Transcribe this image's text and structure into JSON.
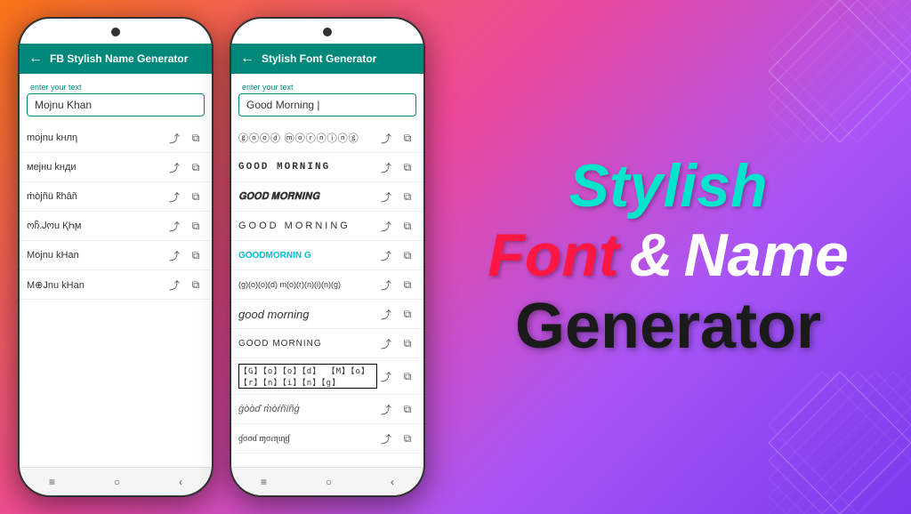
{
  "phone1": {
    "header": {
      "back": "←",
      "title": "FB Stylish Name Generator"
    },
    "input": {
      "label": "enter your text",
      "value": "Mojnu Khan"
    },
    "results": [
      {
        "text": "mojnu kнлη",
        "style": ""
      },
      {
        "text": "мejнu kнди",
        "style": ""
      },
      {
        "text": "ṁòjñü k̃hâñ",
        "style": ""
      },
      {
        "text": "ოჩ.Ꭻოu ҚҺϻ",
        "style": ""
      },
      {
        "text": "Mojnu kHan",
        "style": ""
      },
      {
        "text": "M⊕Jnu kHan",
        "style": ""
      }
    ],
    "nav": [
      "≡",
      "○",
      "‹"
    ]
  },
  "phone2": {
    "header": {
      "back": "←",
      "title": "Stylish Font Generator"
    },
    "input": {
      "label": "enter your text",
      "value": "Good Morning |"
    },
    "results": [
      {
        "text": "ⓖⓞⓞⓓ ⓜⓞⓡⓝⓘⓝⓖ",
        "style": "circled"
      },
      {
        "text": "GOOD MORNING",
        "style": "outlined"
      },
      {
        "text": "𝐆𝐎𝐎𝐃 𝐌𝐎𝐑𝐍𝐈𝐍𝐆",
        "style": "bold-serif"
      },
      {
        "text": "GOOD MORNING",
        "style": "wide"
      },
      {
        "text": "GOODMORNIN G",
        "style": "colored"
      },
      {
        "text": "(g)(o)(o)(d) m(o)(r)(n)(i)(n)(g)",
        "style": "parentheses"
      },
      {
        "text": "good morning",
        "style": "italic-light"
      },
      {
        "text": "GOOD MORNING",
        "style": "caps"
      },
      {
        "text": "【G】【o】【o】【d】 【M】【o】【r】【n】【i】【n】【g】",
        "style": "box"
      },
      {
        "text": "ġòòď ṁòŕñïñġ",
        "style": "fancy"
      },
      {
        "text": "ɠσσɗ ɱσɾɳιɳɠ",
        "style": "script"
      }
    ],
    "nav": [
      "≡",
      "○",
      "‹"
    ]
  },
  "branding": {
    "line1": [
      "Stylish"
    ],
    "line2_font": "Font",
    "line2_amp": "&",
    "line2_name": "Name",
    "line3": "Generator"
  },
  "action_icons": {
    "share": "⤴",
    "copy": "⧉"
  }
}
